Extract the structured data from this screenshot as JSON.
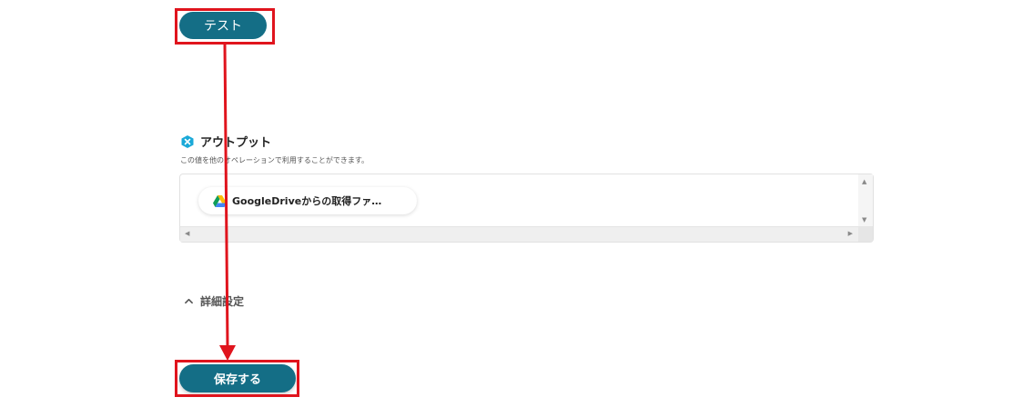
{
  "buttons": {
    "test_label": "テスト",
    "save_label": "保存する"
  },
  "output": {
    "title": "アウトプット",
    "description": "この値を他のオペレーションで利用することができます。",
    "chip_label": "GoogleDriveからの取得ファ…",
    "chip_icon": "google-drive-icon"
  },
  "advanced": {
    "label": "詳細設定",
    "icon": "chevron-up-icon"
  },
  "colors": {
    "button_bg": "#146e86",
    "highlight": "#e0141d",
    "output_icon": "#1aa9d8"
  }
}
